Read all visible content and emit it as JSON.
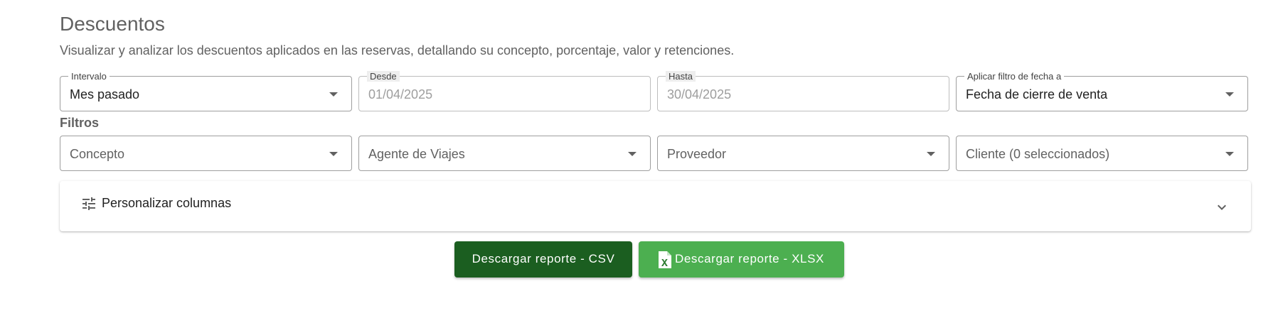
{
  "header": {
    "title": "Descuentos",
    "subtitle": "Visualizar y analizar los descuentos aplicados en las reservas, detallando su concepto, porcentaje, valor y retenciones."
  },
  "date_filters": {
    "interval": {
      "label": "Intervalo",
      "value": "Mes pasado"
    },
    "from": {
      "label": "Desde",
      "value": "01/04/2025"
    },
    "to": {
      "label": "Hasta",
      "value": "30/04/2025"
    },
    "apply_date": {
      "label": "Aplicar filtro de fecha a",
      "value": "Fecha de cierre de venta"
    }
  },
  "filters": {
    "section_label": "Filtros",
    "concept": {
      "placeholder": "Concepto"
    },
    "travel_agent": {
      "placeholder": "Agente de Viajes"
    },
    "provider": {
      "placeholder": "Proveedor"
    },
    "client": {
      "placeholder": "Cliente (0 seleccionados)"
    }
  },
  "columns_panel": {
    "label": "Personalizar columnas",
    "icon": "tune-icon",
    "expand_icon": "chevron-down-icon"
  },
  "actions": {
    "download_csv": "Descargar reporte - CSV",
    "download_xlsx": "Descargar reporte - XLSX",
    "xlsx_icon": "excel-file-icon"
  },
  "colors": {
    "csv_button": "#1b5e20",
    "xlsx_button": "#4caf50",
    "text_muted": "#616161"
  }
}
